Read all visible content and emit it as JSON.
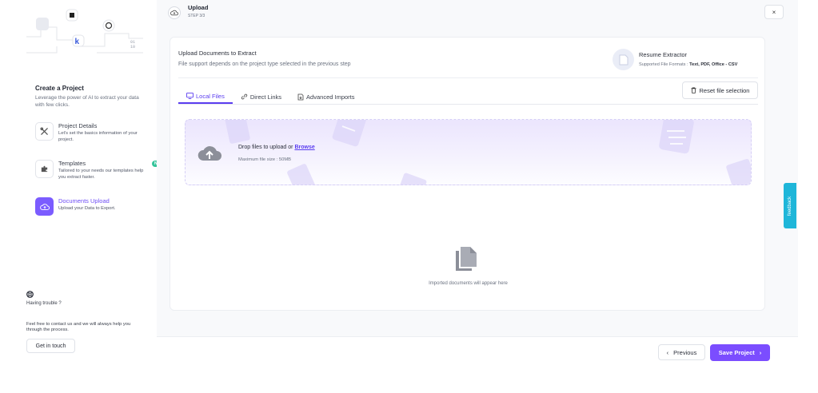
{
  "sidebar": {
    "title": "Create a Project",
    "subtitle": "Leverage the power of AI to extract your data with few clicks.",
    "steps": [
      {
        "label": "Project Details",
        "desc": "Let's set the basics information of your project.",
        "icon": "tools-icon"
      },
      {
        "label": "Templates",
        "desc": "Tailored to your needs our templates help you extract faster.",
        "icon": "puzzle-icon",
        "badge": "NEW"
      },
      {
        "label": "Documents Upload",
        "desc": "Upload your Data to Export.",
        "icon": "cloud-upload-icon",
        "active": true
      }
    ],
    "trouble": "Having trouble ?",
    "contact": "Feel free to contact us and we will always help you through the process.",
    "contact_button": "Get in touch",
    "illustration_letter": "k",
    "illustration_bits": "01\n10"
  },
  "header": {
    "title": "Upload",
    "step": "STEP 3/3",
    "close": "×"
  },
  "card": {
    "title": "Upload Documents to Extract",
    "subtitle": "File support depends on the project type selected in the previous step",
    "extractor_title": "Resume Extractor",
    "formats_label": "Supported File Formats : ",
    "formats_value": "Text, PDF, Office - CSV",
    "reset_label": "Reset file selection",
    "tabs": [
      {
        "label": "Local Files",
        "active": true
      },
      {
        "label": "Direct Links"
      },
      {
        "label": "Advanced Imports"
      }
    ],
    "dropzone": {
      "text": "Drop files to upload or ",
      "browse": "Browse",
      "size": "Maximum file size : 50MB"
    },
    "empty_text": "Imported documents will appear here"
  },
  "footer": {
    "previous": "Previous",
    "save": "Save Project"
  },
  "feedback": "feedback",
  "colors": {
    "accent": "#7b4dff",
    "feedback": "#1fb6d9",
    "badge": "#34c49a"
  }
}
